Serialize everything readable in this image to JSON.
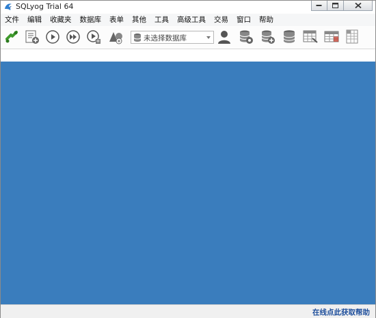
{
  "window": {
    "title": "SQLyog Trial 64"
  },
  "menu": {
    "items": [
      "文件",
      "编辑",
      "收藏夹",
      "数据库",
      "表单",
      "其他",
      "工具",
      "高级工具",
      "交易",
      "窗口",
      "帮助"
    ]
  },
  "toolbar": {
    "db_select_placeholder": "未选择数据库",
    "icons": [
      "connect-icon",
      "new-query-icon",
      "execute-icon",
      "execute-all-icon",
      "execute-edit-icon",
      "schema-icon",
      "user-manager-icon",
      "backup-db-icon",
      "restore-db-icon",
      "database-icon",
      "table-data-icon",
      "table-grid-icon",
      "table-structure-icon"
    ]
  },
  "statusbar": {
    "help_link": "在线点此获取帮助"
  },
  "colors": {
    "workspace": "#3a7dbd",
    "link": "#1f4f9c"
  }
}
